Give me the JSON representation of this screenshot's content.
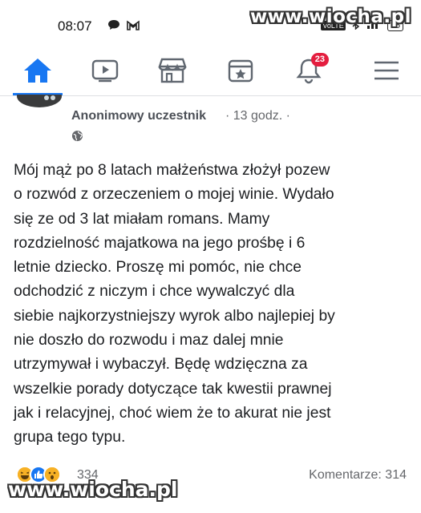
{
  "status_bar": {
    "time": "08:07",
    "battery": "55"
  },
  "watermark": {
    "top": "www.wiocha.pl",
    "bottom": "www.wiocha.pl"
  },
  "nav": {
    "items": [
      {
        "icon": "home-icon",
        "active": true
      },
      {
        "icon": "video-icon"
      },
      {
        "icon": "marketplace-icon"
      },
      {
        "icon": "news-icon"
      },
      {
        "icon": "bell-icon",
        "badge": "23"
      },
      {
        "icon": "menu-icon"
      }
    ],
    "accent_color": "#1877f2",
    "badge_color": "#e41e3f"
  },
  "post": {
    "author": "Anonimowy uczestnik",
    "time": "· 13 godz. ·",
    "privacy_icon": "globe-icon",
    "lines": [
      "Mój mąż po 8 latach małżeństwa złożył pozew",
      "o rozwód z orzeczeniem o mojej winie. Wydało",
      "się ze od 3 lat miałam romans. Mamy",
      "rozdzielność majatkowa na jego prośbę i 6",
      "letnie dziecko. Proszę mi pomóc, nie chce",
      "odchodzić z niczym i chce wywalczyć dla",
      "siebie najkorzystniejszy wyrok albo najlepiej by",
      "nie doszło do rozwodu i maz dalej mnie",
      "utrzymywał i wybaczył. Będę wdzięczna za",
      "wszelkie porady dotyczące tak kwestii prawnej",
      "jak i relacyjnej, choć wiem że to akurat nie jest",
      "grupa tego typu."
    ]
  },
  "footer": {
    "reactions": [
      "haha-icon",
      "like-icon",
      "wow-icon"
    ],
    "reaction_count": "334",
    "comments": "Komentarze: 314"
  }
}
